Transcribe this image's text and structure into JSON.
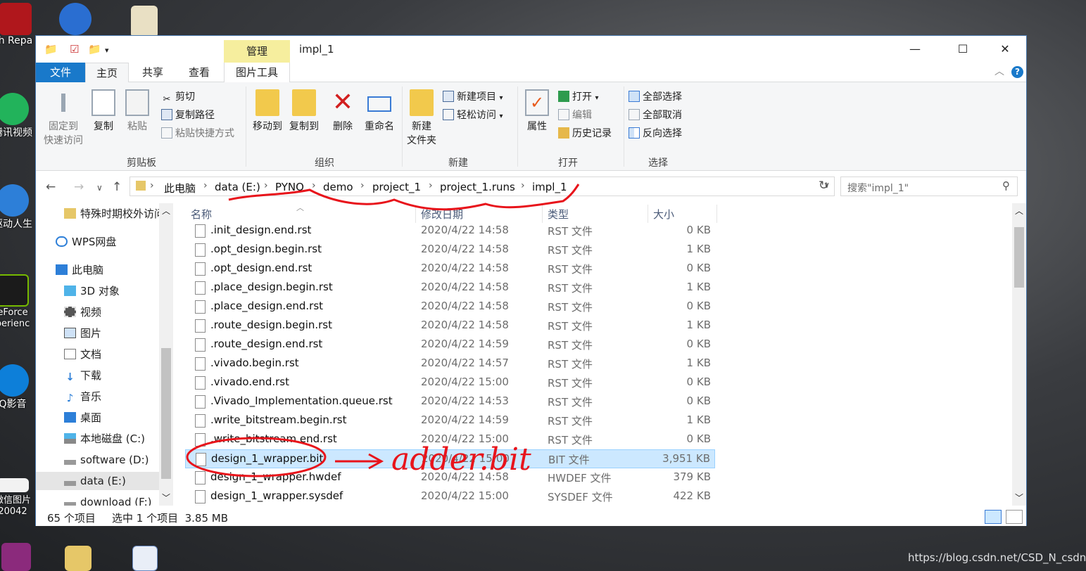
{
  "desktop": {
    "icons": [
      {
        "label": "h Repa",
        "icon": "flash-repair-icon"
      },
      {
        "label": "腾讯视频",
        "icon": "tencent-video-icon"
      },
      {
        "label": "驱动人生",
        "icon": "driver-life-icon"
      },
      {
        "label": "eForce\nperienc",
        "icon": "geforce-experience-icon"
      },
      {
        "label": "Q影音",
        "icon": "qq-player-icon"
      },
      {
        "label": "微信图片\n20042",
        "icon": "image-file-icon"
      }
    ],
    "watermark": "https://blog.csdn.net/CSD_N_csdn"
  },
  "window": {
    "title": "impl_1",
    "context_tab": "管理",
    "controls": {
      "minimize": "—",
      "maximize": "☐",
      "close": "✕"
    }
  },
  "ribbon": {
    "tabs": [
      "文件",
      "主页",
      "共享",
      "查看",
      "图片工具"
    ],
    "active_tab": "主页",
    "groups": {
      "clipboard": {
        "label": "剪贴板",
        "pin": "固定到\n快速访问",
        "copy": "复制",
        "paste": "粘贴",
        "cut": "剪切",
        "copy_path": "复制路径",
        "paste_shortcut": "粘贴快捷方式"
      },
      "organize": {
        "label": "组织",
        "move_to": "移动到",
        "copy_to": "复制到",
        "delete": "删除",
        "rename": "重命名"
      },
      "new": {
        "label": "新建",
        "new_folder": "新建\n文件夹",
        "new_item": "新建项目",
        "easy_access": "轻松访问"
      },
      "open": {
        "label": "打开",
        "properties": "属性",
        "open": "打开",
        "edit": "编辑",
        "history": "历史记录"
      },
      "select": {
        "label": "选择",
        "select_all": "全部选择",
        "select_none": "全部取消",
        "invert": "反向选择"
      }
    }
  },
  "address": {
    "breadcrumbs": [
      "此电脑",
      "data (E:)",
      "PYNQ",
      "demo",
      "project_1",
      "project_1.runs",
      "impl_1"
    ],
    "search_placeholder": "搜索\"impl_1\""
  },
  "nav": {
    "items": [
      {
        "label": "特殊时期校外访问",
        "icon": "folder-icon",
        "level": 1
      },
      {
        "label": "WPS网盘",
        "icon": "cloud-icon",
        "level": 0
      },
      {
        "label": "此电脑",
        "icon": "computer-icon",
        "level": 0
      },
      {
        "label": "3D 对象",
        "icon": "cube-icon",
        "level": 1
      },
      {
        "label": "视频",
        "icon": "video-icon",
        "level": 1
      },
      {
        "label": "图片",
        "icon": "picture-icon",
        "level": 1
      },
      {
        "label": "文档",
        "icon": "document-icon",
        "level": 1
      },
      {
        "label": "下载",
        "icon": "download-icon",
        "level": 1
      },
      {
        "label": "音乐",
        "icon": "music-icon",
        "level": 1
      },
      {
        "label": "桌面",
        "icon": "desktop-icon",
        "level": 1
      },
      {
        "label": "本地磁盘 (C:)",
        "icon": "windows-drive-icon",
        "level": 1
      },
      {
        "label": "software (D:)",
        "icon": "drive-icon",
        "level": 1
      },
      {
        "label": "data (E:)",
        "icon": "drive-icon",
        "level": 1,
        "selected": true
      },
      {
        "label": "download (F:)",
        "icon": "drive-icon",
        "level": 1
      }
    ]
  },
  "list": {
    "columns": [
      "名称",
      "修改日期",
      "类型",
      "大小"
    ],
    "rows": [
      {
        "name": ".init_design.end.rst",
        "date": "2020/4/22 14:58",
        "type": "RST 文件",
        "size": "0 KB"
      },
      {
        "name": ".opt_design.begin.rst",
        "date": "2020/4/22 14:58",
        "type": "RST 文件",
        "size": "1 KB"
      },
      {
        "name": ".opt_design.end.rst",
        "date": "2020/4/22 14:58",
        "type": "RST 文件",
        "size": "0 KB"
      },
      {
        "name": ".place_design.begin.rst",
        "date": "2020/4/22 14:58",
        "type": "RST 文件",
        "size": "1 KB"
      },
      {
        "name": ".place_design.end.rst",
        "date": "2020/4/22 14:58",
        "type": "RST 文件",
        "size": "0 KB"
      },
      {
        "name": ".route_design.begin.rst",
        "date": "2020/4/22 14:58",
        "type": "RST 文件",
        "size": "1 KB"
      },
      {
        "name": ".route_design.end.rst",
        "date": "2020/4/22 14:59",
        "type": "RST 文件",
        "size": "0 KB"
      },
      {
        "name": ".vivado.begin.rst",
        "date": "2020/4/22 14:57",
        "type": "RST 文件",
        "size": "1 KB"
      },
      {
        "name": ".vivado.end.rst",
        "date": "2020/4/22 15:00",
        "type": "RST 文件",
        "size": "0 KB"
      },
      {
        "name": ".Vivado_Implementation.queue.rst",
        "date": "2020/4/22 14:53",
        "type": "RST 文件",
        "size": "0 KB"
      },
      {
        "name": ".write_bitstream.begin.rst",
        "date": "2020/4/22 14:59",
        "type": "RST 文件",
        "size": "1 KB"
      },
      {
        "name": ".write_bitstream.end.rst",
        "date": "2020/4/22 15:00",
        "type": "RST 文件",
        "size": "0 KB"
      },
      {
        "name": "design_1_wrapper.bit",
        "date": "2020/4/22 15:00",
        "type": "BIT 文件",
        "size": "3,951 KB",
        "selected": true
      },
      {
        "name": "design_1_wrapper.hwdef",
        "date": "2020/4/22 14:58",
        "type": "HWDEF 文件",
        "size": "379 KB"
      },
      {
        "name": "design_1_wrapper.sysdef",
        "date": "2020/4/22 15:00",
        "type": "SYSDEF 文件",
        "size": "422 KB"
      }
    ]
  },
  "status": {
    "count": "65 个项目",
    "selection": "选中 1 个项目  3.85 MB"
  },
  "annotation": {
    "text": "adder.bit",
    "color": "#e8141b"
  },
  "colors": {
    "accent": "#1979ca",
    "selection": "#cce8ff",
    "context_tab": "#f6ee9e"
  }
}
